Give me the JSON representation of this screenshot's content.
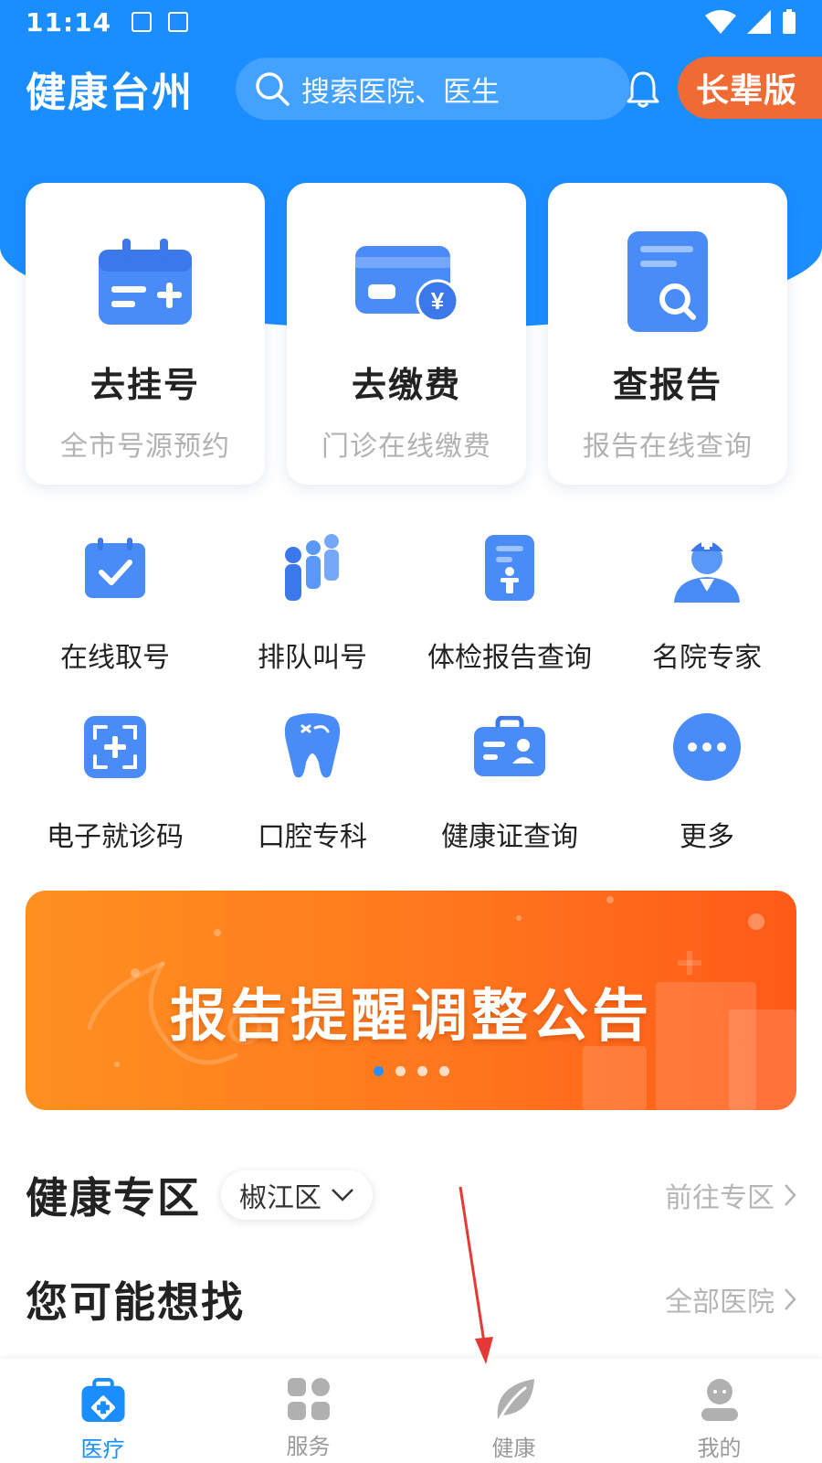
{
  "status_bar": {
    "time": "11:14"
  },
  "header": {
    "app_title": "健康台州",
    "search_placeholder": "搜索医院、医生",
    "elder_mode_label": "长辈版"
  },
  "main_cards": [
    {
      "title": "去挂号",
      "subtitle": "全市号源预约",
      "icon": "calendar-add-icon"
    },
    {
      "title": "去缴费",
      "subtitle": "门诊在线缴费",
      "icon": "payment-card-icon"
    },
    {
      "title": "查报告",
      "subtitle": "报告在线查询",
      "icon": "report-search-icon"
    }
  ],
  "services_row1": [
    {
      "label": "在线取号",
      "icon": "calendar-check-icon"
    },
    {
      "label": "排队叫号",
      "icon": "queue-people-icon"
    },
    {
      "label": "体检报告查询",
      "icon": "checkup-report-icon"
    },
    {
      "label": "名院专家",
      "icon": "doctor-icon"
    }
  ],
  "services_row2": [
    {
      "label": "电子就诊码",
      "icon": "scan-code-icon"
    },
    {
      "label": "口腔专科",
      "icon": "tooth-icon"
    },
    {
      "label": "健康证查询",
      "icon": "health-card-icon"
    },
    {
      "label": "更多",
      "icon": "more-icon"
    }
  ],
  "banner": {
    "text": "报告提醒调整公告",
    "page_count": 4,
    "active_page": 1
  },
  "health_zone": {
    "title": "健康专区",
    "district": "椒江区",
    "link": "前往专区"
  },
  "suggest": {
    "title": "您可能想找",
    "link": "全部医院"
  },
  "tabs": [
    {
      "label": "医疗",
      "icon": "medical-kit-icon",
      "active": true
    },
    {
      "label": "服务",
      "icon": "grid-apps-icon",
      "active": false
    },
    {
      "label": "健康",
      "icon": "leaf-icon",
      "active": false
    },
    {
      "label": "我的",
      "icon": "user-icon",
      "active": false
    }
  ],
  "colors": {
    "primary": "#1a8dff",
    "accent_orange": "#f06a33",
    "icon_blue": "#3b82f6",
    "annotation_red": "#e53935"
  }
}
